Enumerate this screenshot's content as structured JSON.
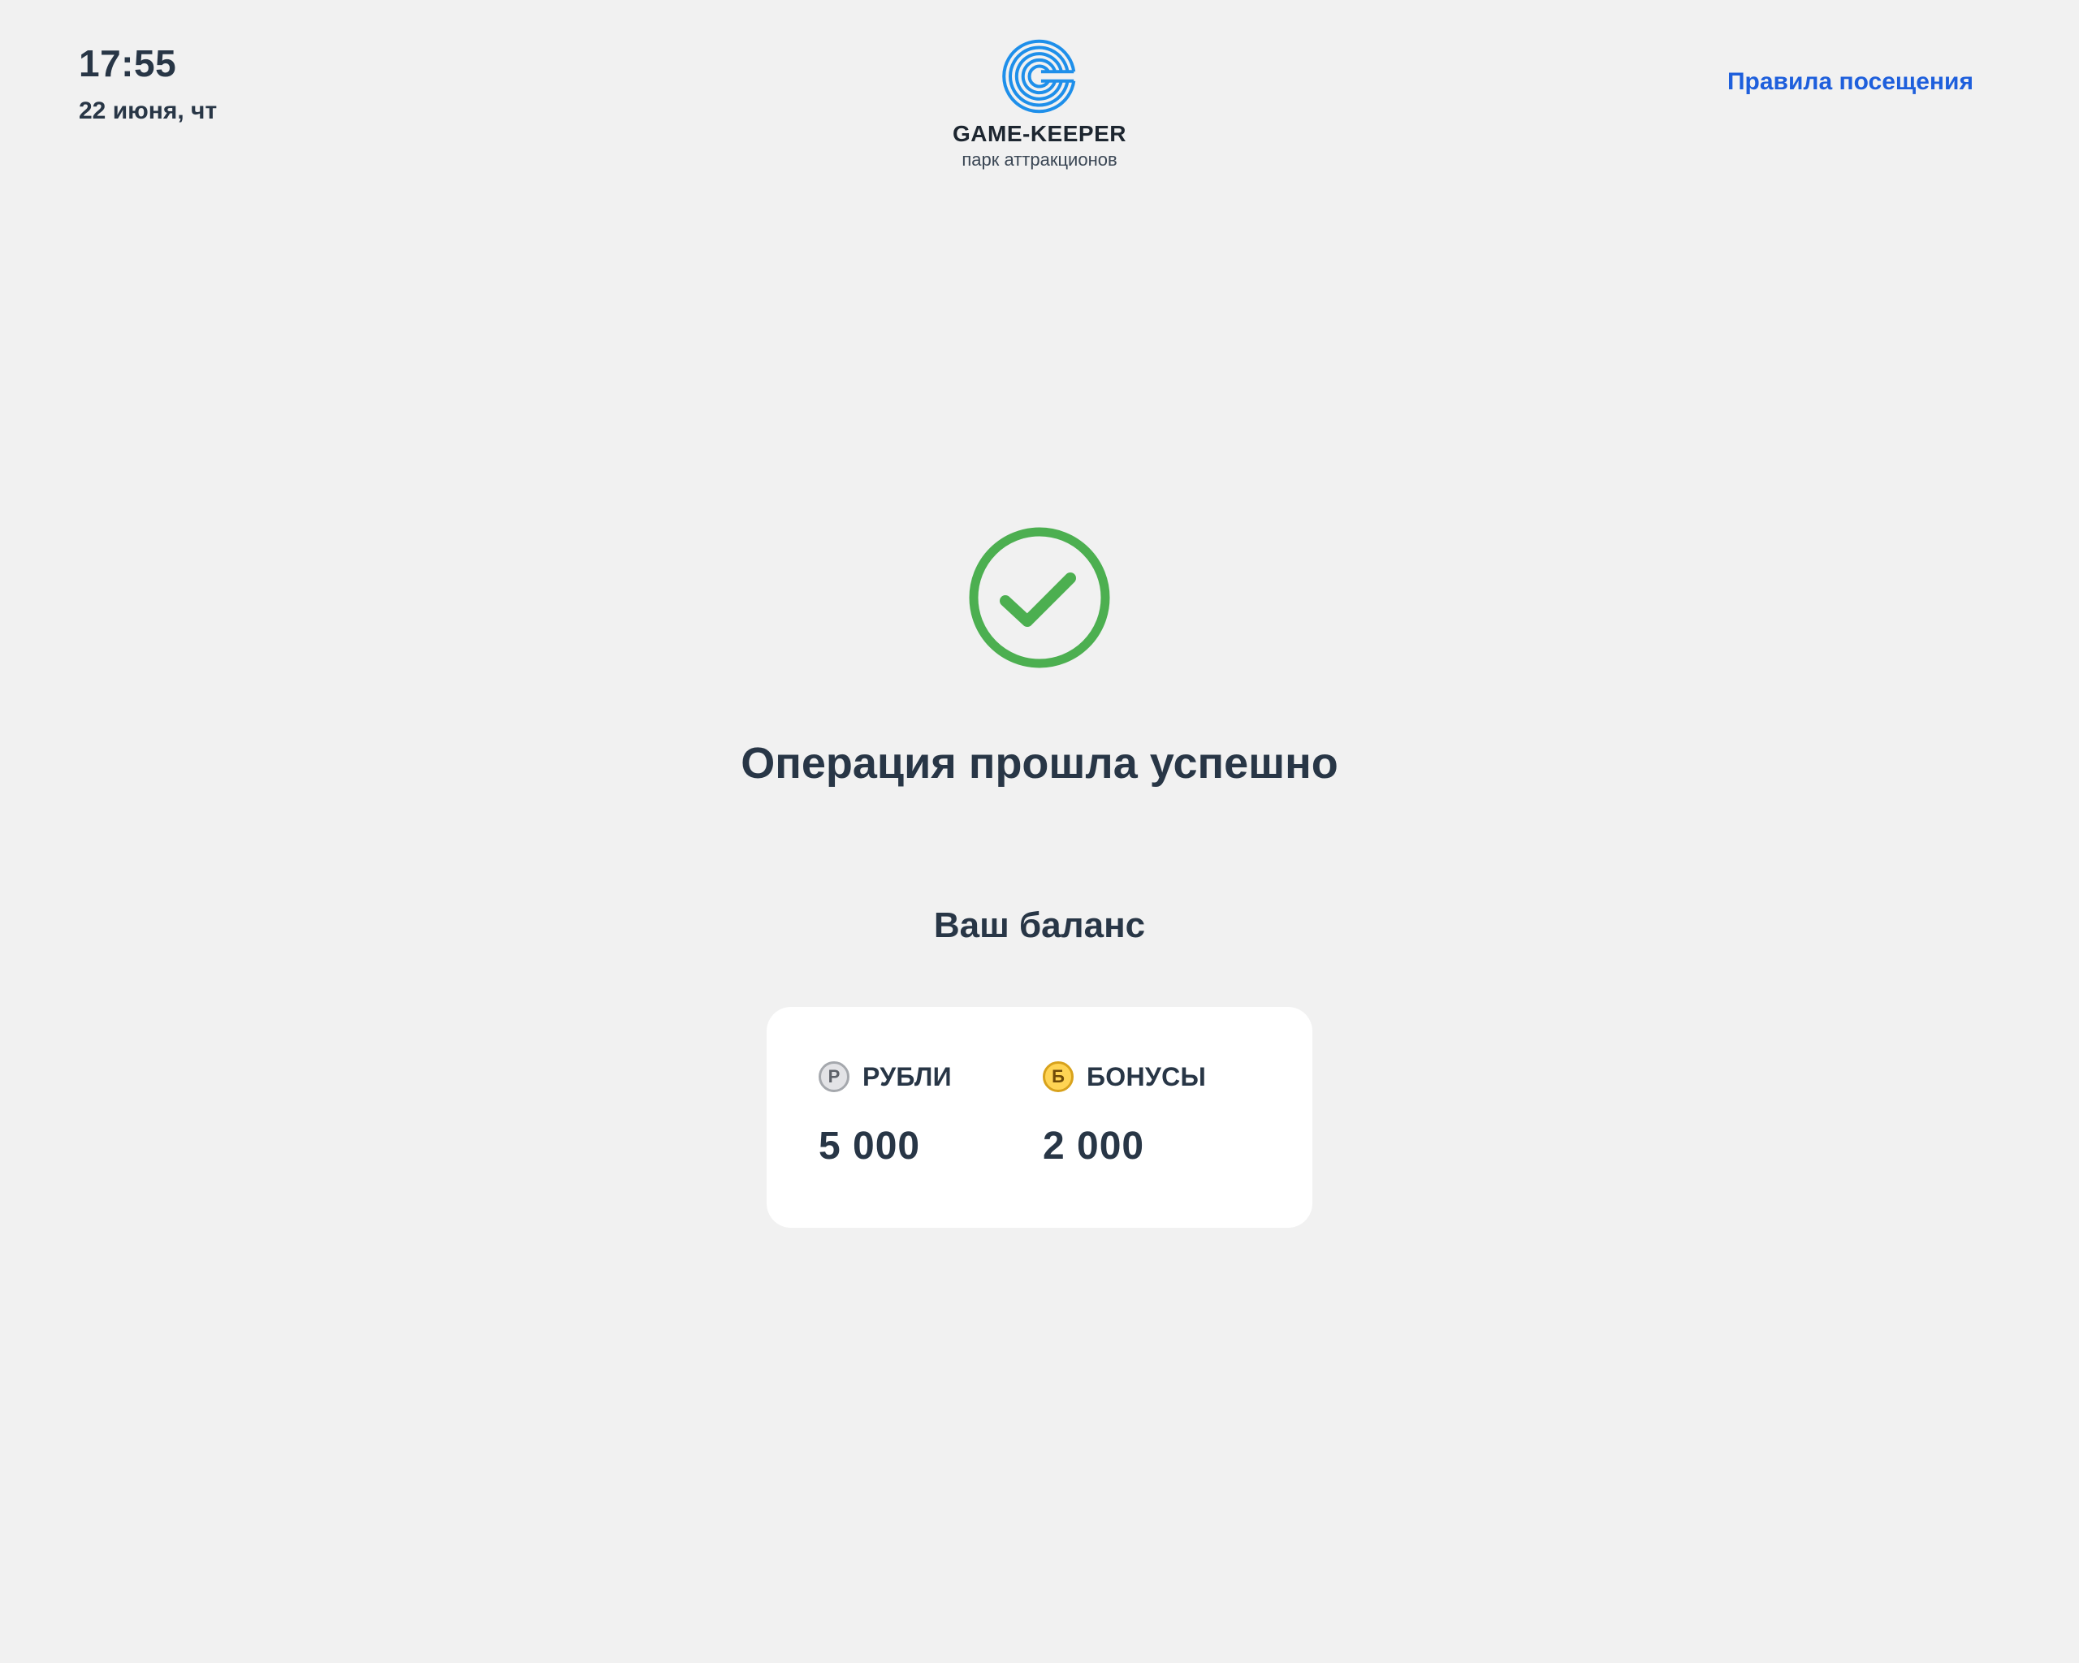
{
  "header": {
    "time": "17:55",
    "date": "22 июня, чт",
    "rules_link": "Правила посещения"
  },
  "logo": {
    "name": "GAME-KEEPER",
    "subtitle": "парк аттракционов",
    "color": "#1e8fea"
  },
  "status": {
    "icon": "check-circle-icon",
    "color": "#4caf50",
    "message": "Операция прошла успешно"
  },
  "balance": {
    "title": "Ваш баланс",
    "items": [
      {
        "icon": "ruble-coin-icon",
        "symbol": "Р",
        "label": "РУБЛИ",
        "value": "5 000"
      },
      {
        "icon": "bonus-coin-icon",
        "symbol": "Б",
        "label": "БОНУСЫ",
        "value": "2 000"
      }
    ]
  },
  "colors": {
    "background": "#f1f1f1",
    "text": "#283646",
    "link": "#1e5fdc"
  }
}
